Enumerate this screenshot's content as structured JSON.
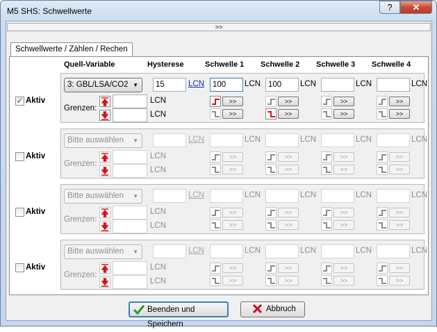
{
  "window": {
    "title": "M5 SHS: Schwellwerte",
    "help_label": "?",
    "close_label": "✕"
  },
  "expander_label": ">>",
  "tab_label": "Schwellwerte / Zählen / Rechen",
  "headers": {
    "quelle": "Quell-Variable",
    "hysterese": "Hysterese",
    "schwelle1": "Schwelle 1",
    "schwelle2": "Schwelle 2",
    "schwelle3": "Schwelle 3",
    "schwelle4": "Schwelle 4"
  },
  "common": {
    "aktiv_label": "Aktiv",
    "grenzen_label": "Grenzen:",
    "unit": "LCN",
    "arrow_button": ">>"
  },
  "rows": [
    {
      "aktiv": true,
      "source": "3: GBL/LSA/CO2",
      "hysterese": "15",
      "schwelle1": "100",
      "schwelle2": "100",
      "schwelle3": "",
      "schwelle4": ""
    },
    {
      "aktiv": false,
      "source": "Bitte auswählen",
      "hysterese": "",
      "schwelle1": "",
      "schwelle2": "",
      "schwelle3": "",
      "schwelle4": ""
    },
    {
      "aktiv": false,
      "source": "Bitte auswählen",
      "hysterese": "",
      "schwelle1": "",
      "schwelle2": "",
      "schwelle3": "",
      "schwelle4": ""
    },
    {
      "aktiv": false,
      "source": "Bitte auswählen",
      "hysterese": "",
      "schwelle1": "",
      "schwelle2": "",
      "schwelle3": "",
      "schwelle4": ""
    }
  ],
  "footer": {
    "ok_label": "Beenden und Speichern",
    "cancel_label": "Abbruch"
  },
  "colors": {
    "red": "#d4141c",
    "check_green": "#1f9a2a",
    "link_blue": "#0b28c8"
  }
}
